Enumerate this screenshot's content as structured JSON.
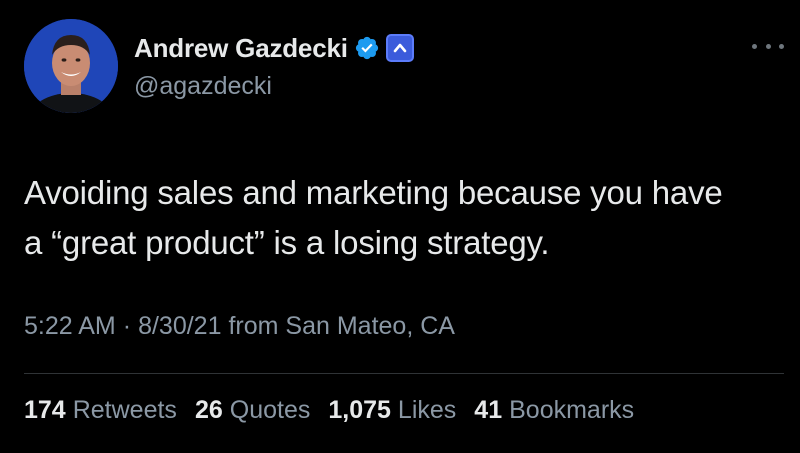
{
  "author": {
    "display_name": "Andrew Gazdecki",
    "handle": "@agazdecki",
    "verified_color": "#1d9bf0",
    "affiliate_badge_color": "#3b5bdb"
  },
  "tweet": {
    "text_line1": "Avoiding sales and marketing because you have",
    "text_line2": "a “great product” is a losing strategy.",
    "time": "5:22 AM",
    "separator": "·",
    "date": "8/30/21",
    "location": "from San Mateo, CA"
  },
  "stats": [
    {
      "count": "174",
      "label": "Retweets"
    },
    {
      "count": "26",
      "label": "Quotes"
    },
    {
      "count": "1,075",
      "label": "Likes"
    },
    {
      "count": "41",
      "label": "Bookmarks"
    }
  ],
  "icons": {
    "more": "more-horizontal-icon",
    "verified": "verified-badge-icon",
    "affiliate": "affiliate-badge-icon"
  },
  "colors": {
    "background": "#000000",
    "primary_text": "#e7e9ea",
    "secondary_text": "#8b98a5",
    "divider": "#2f3336"
  }
}
